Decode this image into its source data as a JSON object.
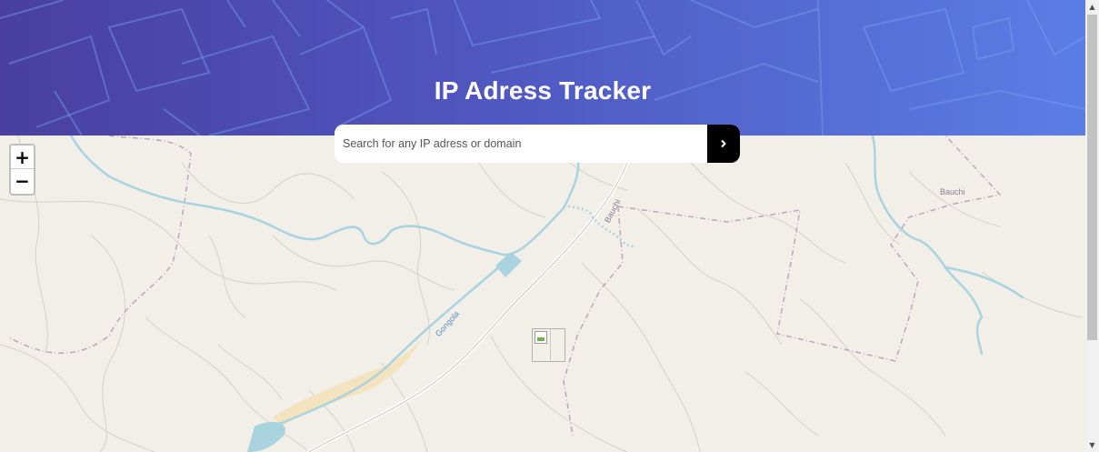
{
  "header": {
    "title": "IP Adress Tracker"
  },
  "search": {
    "placeholder": "Search for any IP adress or domain",
    "submit_icon": "chevron-right-icon"
  },
  "map": {
    "zoom_in_label": "+",
    "zoom_out_label": "−",
    "labels": {
      "town": "Bauchi",
      "road": "Bauchi",
      "river": "Gongola"
    },
    "marker_icon": "location-marker-icon"
  },
  "colors": {
    "header_start": "#4a3fa0",
    "header_end": "#5a7ee6",
    "map_bg": "#f2efe9",
    "river": "#a9d3df",
    "boundary": "#b89cb8",
    "search_button": "#000000"
  }
}
